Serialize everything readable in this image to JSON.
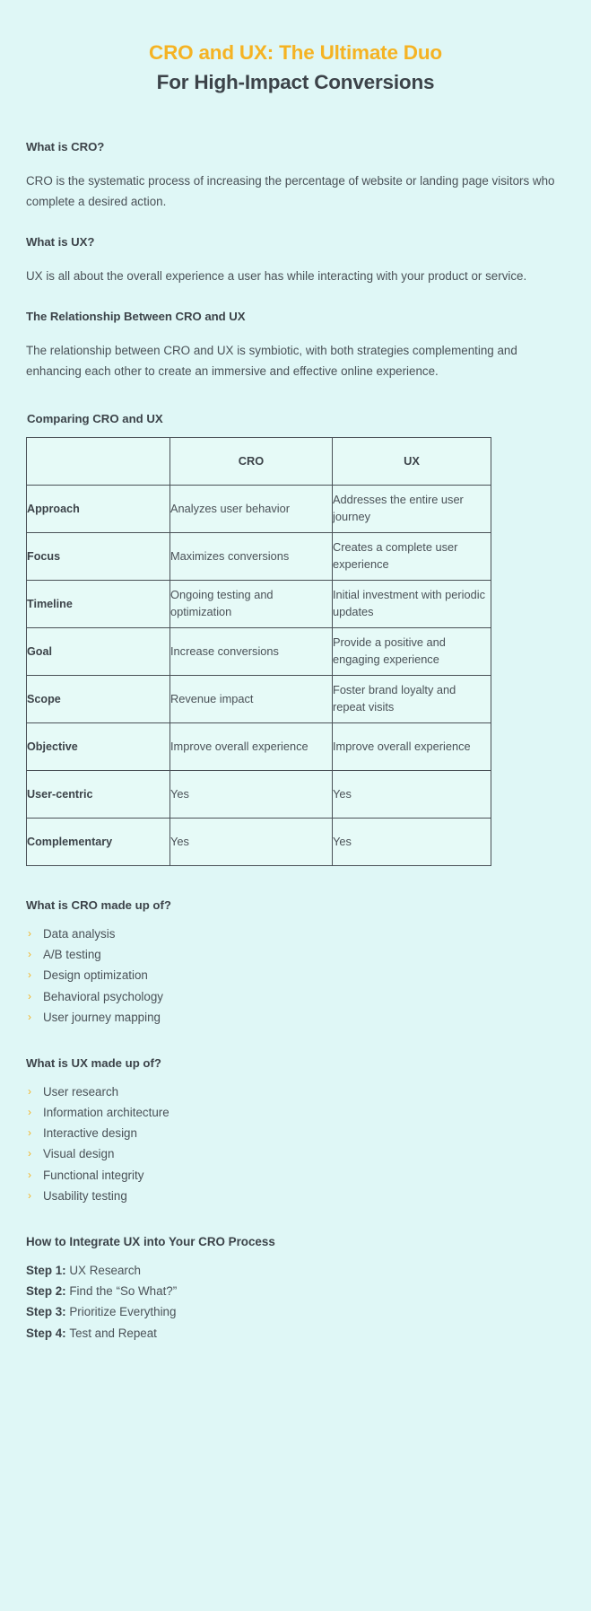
{
  "colors": {
    "background": "#dff7f6",
    "accent": "#f5b323",
    "text": "#3c4349",
    "body_text": "#4a5157",
    "table_border": "#4a5157",
    "table_fill": "#e6faf7"
  },
  "title": {
    "line1": "CRO and UX: The Ultimate Duo",
    "line2": "For High-Impact Conversions"
  },
  "sections": [
    {
      "heading": "What is CRO?",
      "body": "CRO is the systematic process of increasing the percentage of website or landing page visitors who complete a desired action."
    },
    {
      "heading": "What is UX?",
      "body": "UX is all about the overall experience a user has while interacting with your product or service."
    },
    {
      "heading": "The Relationship Between CRO and UX",
      "body": "The relationship between CRO and UX is symbiotic, with both strategies complementing and enhancing each other to create an immersive and effective online experience."
    }
  ],
  "table": {
    "title": "Comparing CRO and UX",
    "headers": [
      "",
      "CRO",
      "UX"
    ],
    "rows": [
      {
        "label": "Approach",
        "cro": "Analyzes user behavior",
        "ux": "Addresses the entire user journey"
      },
      {
        "label": "Focus",
        "cro": "Maximizes conversions",
        "ux": "Creates a complete user experience"
      },
      {
        "label": "Timeline",
        "cro": "Ongoing testing and optimization",
        "ux": "Initial investment with periodic updates"
      },
      {
        "label": "Goal",
        "cro": "Increase conversions",
        "ux": "Provide a positive and engaging experience"
      },
      {
        "label": "Scope",
        "cro": "Revenue impact",
        "ux": "Foster brand loyalty and repeat visits"
      },
      {
        "label": "Objective",
        "cro": "Improve overall experience",
        "ux": "Improve overall experience"
      },
      {
        "label": "User-centric",
        "cro": "Yes",
        "ux": "Yes"
      },
      {
        "label": "Complementary",
        "cro": "Yes",
        "ux": "Yes"
      }
    ]
  },
  "cro_makeup": {
    "heading": "What is CRO made up of?",
    "items": [
      "Data analysis",
      "A/B testing",
      "Design optimization",
      "Behavioral psychology",
      "User journey mapping"
    ]
  },
  "ux_makeup": {
    "heading": "What is UX made up of?",
    "items": [
      "User research",
      "Information architecture",
      "Interactive design",
      "Visual design",
      "Functional integrity",
      "Usability testing"
    ]
  },
  "integrate": {
    "heading": "How to Integrate UX into Your CRO Process",
    "steps": [
      {
        "label": "Step 1:",
        "text": "UX Research"
      },
      {
        "label": "Step 2:",
        "text": "Find the “So What?”"
      },
      {
        "label": "Step 3:",
        "text": "Prioritize Everything"
      },
      {
        "label": "Step 4:",
        "text": "Test and Repeat"
      }
    ]
  },
  "icons": {
    "bullet": "›"
  }
}
